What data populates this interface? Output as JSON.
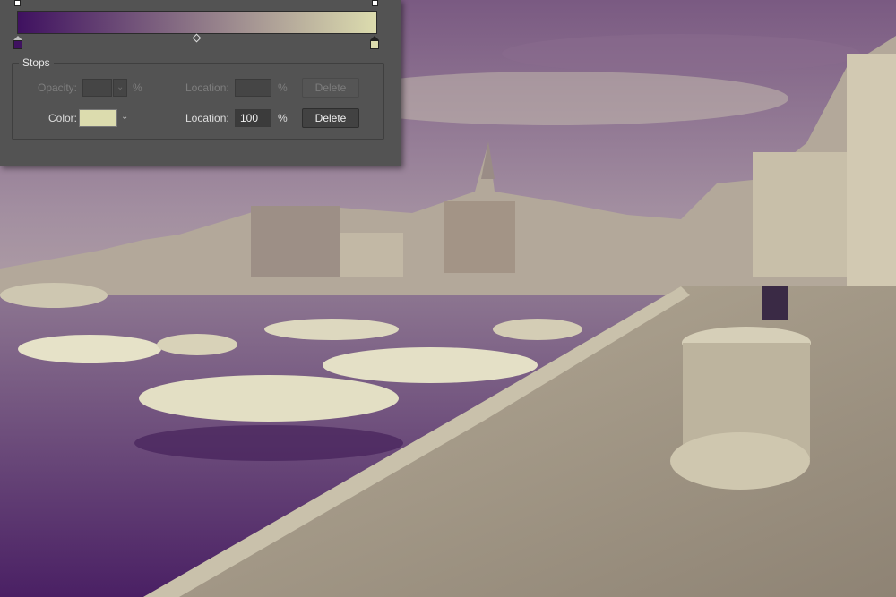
{
  "colors": {
    "gradient_start": "#3f1160",
    "gradient_end": "#dcdcae",
    "panel_bg": "#535353"
  },
  "gradient_editor": {
    "stops_title": "Stops",
    "opacity_row": {
      "opacity_label": "Opacity:",
      "opacity_value": "",
      "opacity_unit": "%",
      "location_label": "Location:",
      "location_value": "",
      "location_unit": "%",
      "delete_label": "Delete",
      "enabled": false
    },
    "color_row": {
      "color_label": "Color:",
      "color_value": "#dcdcae",
      "location_label": "Location:",
      "location_value": "100",
      "location_unit": "%",
      "delete_label": "Delete",
      "enabled": true
    },
    "color_stops": [
      {
        "color": "#3f1160",
        "location_percent": 0,
        "selected": false
      },
      {
        "color": "#dcdcae",
        "location_percent": 100,
        "selected": true
      }
    ],
    "opacity_stops": [
      {
        "location_percent": 0
      },
      {
        "location_percent": 100
      }
    ],
    "midpoint_percent": 50
  },
  "icons": {
    "dropdown": "chevron-down-icon"
  }
}
